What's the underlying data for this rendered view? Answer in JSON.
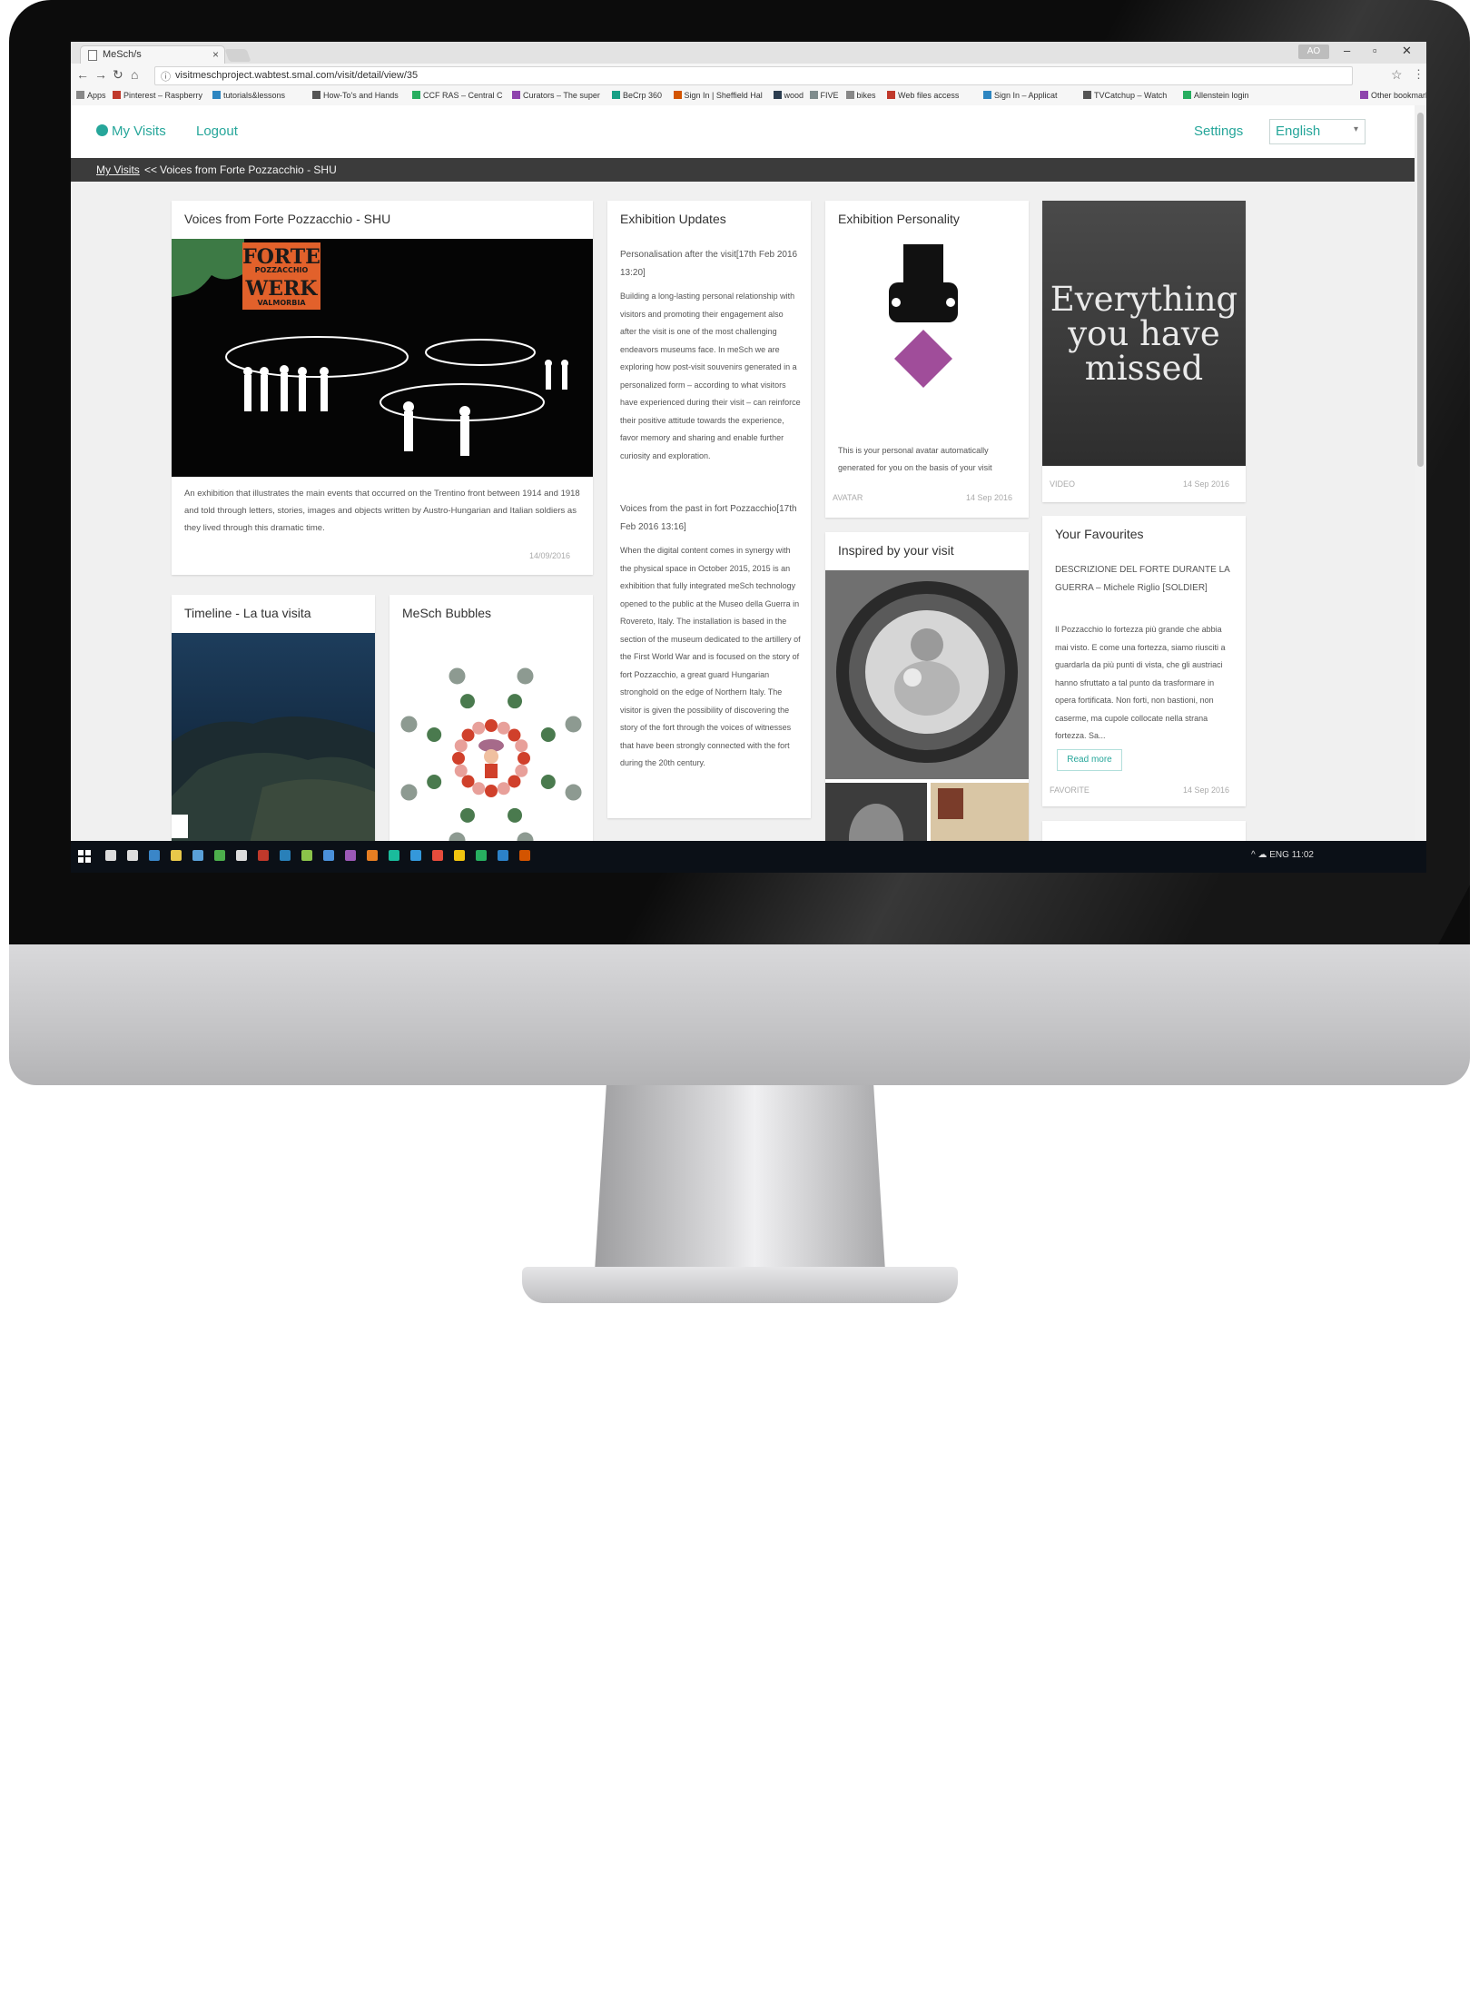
{
  "browser": {
    "tab_title": "MeSch/s",
    "tab_close": "×",
    "url": "visitmeschproject.wabtest.smal.com/visit/detail/view/35",
    "user_chip": "AO",
    "win_minimize": "–",
    "win_maximize": "▫",
    "win_close": "✕",
    "bookmarks": [
      "Apps",
      "Pinterest – Raspberry",
      "tutorials&lessons",
      "How-To's and Hands",
      "CCF RAS – Central C",
      "Curators – The super",
      "BeCrp 360",
      "Sign In | Sheffield Hal",
      "wood",
      "FIVE",
      "bikes",
      "Web files access",
      "Sign In – Applicat",
      "TVCatchup – Watch",
      "Allenstein login",
      "Other bookmarks"
    ]
  },
  "app": {
    "nav_my_visits": "My Visits",
    "nav_logout": "Logout",
    "nav_settings": "Settings",
    "language": "English"
  },
  "breadcrumb": {
    "link": "My Visits",
    "separator": "<<",
    "current": "Voices from Forte Pozzacchio - SHU"
  },
  "cards": {
    "voices": {
      "title": "Voices from Forte Pozzacchio - SHU",
      "poster_line1": "FORTE",
      "poster_line2": "POZZACCHIO",
      "poster_line3": "WERK",
      "poster_line4": "VALMORBIA",
      "description": "An exhibition that illustrates the main events that occurred on the Trentino front between 1914 and 1918 and told through letters, stories, images and objects written by Austro-Hungarian and Italian soldiers as they lived through this dramatic time.",
      "date": "14/09/2016"
    },
    "updates": {
      "title": "Exhibition Updates",
      "item1_heading": "Personalisation after the visit[17th Feb 2016 13:20]",
      "item1_body": "Building a long-lasting personal relationship with visitors and promoting their engagement also after the visit is one of the most challenging endeavors museums face. In meSch we are exploring how post-visit souvenirs generated in a personalized form – according to what visitors have experienced during their visit – can reinforce their positive attitude towards the experience, favor memory and sharing and enable further curiosity and exploration.",
      "item2_heading": "Voices from the past in fort Pozzacchio[17th Feb 2016 13:16]",
      "item2_body": "When the digital content comes in synergy with the physical space in October 2015, 2015 is an exhibition that fully integrated meSch technology opened to the public at the Museo della Guerra in Rovereto, Italy. The installation is based in the section of the museum dedicated to the artillery of the First World War and is focused on the story of fort Pozzacchio, a great guard Hungarian stronghold on the edge of Northern Italy. The visitor is given the possibility of discovering the story of the fort through the voices of witnesses that have been strongly connected with the fort during the 20th century."
    },
    "personality": {
      "title": "Exhibition Personality",
      "caption": "This is your personal avatar automatically generated for you on the basis of your visit",
      "meta_left": "AVATAR",
      "meta_right": "14 Sep 2016"
    },
    "missed": {
      "headline_line1": "Everything",
      "headline_line2": "you have",
      "headline_line3": "missed",
      "meta_left": "VIDEO",
      "meta_right": "14 Sep 2016"
    },
    "timeline": {
      "title": "Timeline - La tua visita"
    },
    "bubbles": {
      "title": "MeSch Bubbles",
      "colors": {
        "dark_green": "#4a7a4e",
        "grey": "#8d9a91",
        "red": "#d0402b",
        "pink": "#e8a09a",
        "mauve": "#a66a8a"
      }
    },
    "inspired": {
      "title": "Inspired by your visit"
    },
    "favourites": {
      "title": "Your Favourites",
      "item_heading": "DESCRIZIONE DEL FORTE DURANTE LA GUERRA – Michele Riglio [SOLDIER]",
      "item_body": "Il Pozzacchio lo fortezza più grande che abbia mai visto. E come una fortezza, siamo riusciti a guardarla da più punti di vista, che gli austriaci hanno sfruttato a tal punto da trasformare in opera fortificata. Non forti, non bastioni, non caserme, ma cupole collocate nella strana fortezza. Sa...",
      "read_more": "Read more",
      "meta_left": "FAVORITE",
      "meta_right": "14 Sep 2016"
    }
  },
  "taskbar": {
    "tray": "^  ☁  ENG  11:02"
  }
}
